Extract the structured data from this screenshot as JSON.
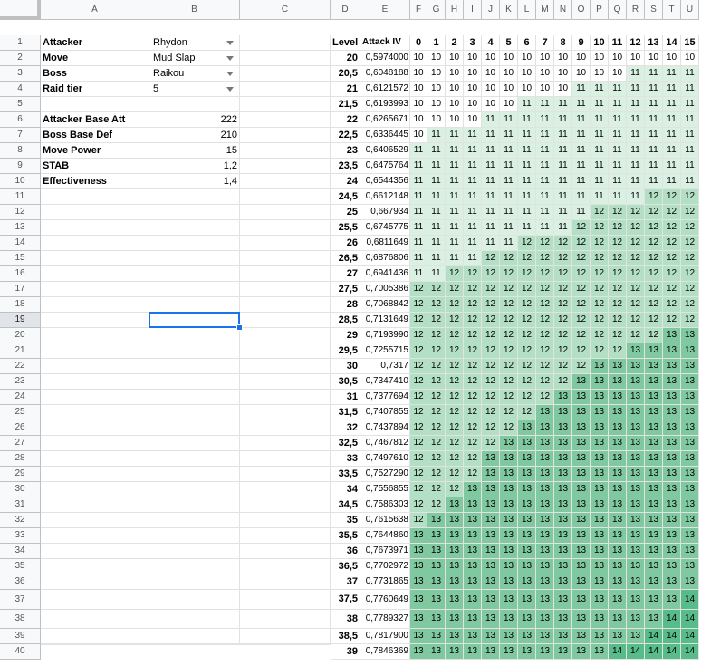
{
  "columns": [
    "A",
    "B",
    "C",
    "D",
    "E",
    "F",
    "G",
    "H",
    "I",
    "J",
    "K",
    "L",
    "M",
    "N",
    "O",
    "P",
    "Q",
    "R",
    "S",
    "T",
    "U"
  ],
  "rows": [
    "1",
    "2",
    "3",
    "4",
    "5",
    "6",
    "7",
    "8",
    "9",
    "10",
    "11",
    "12",
    "13",
    "14",
    "15",
    "16",
    "17",
    "18",
    "19",
    "20",
    "21",
    "22",
    "23",
    "24",
    "25",
    "26",
    "27",
    "28",
    "29",
    "30",
    "31",
    "32",
    "33",
    "34",
    "35",
    "36",
    "37",
    "38",
    "39",
    "40"
  ],
  "active_row": "19",
  "params": [
    {
      "label": "Attacker",
      "value": "Rhydon",
      "dropdown": true
    },
    {
      "label": "Move",
      "value": "Mud Slap",
      "dropdown": true
    },
    {
      "label": "Boss",
      "value": "Raikou",
      "dropdown": true
    },
    {
      "label": "Raid tier",
      "value": "5",
      "dropdown": true
    },
    {
      "label": "",
      "value": "",
      "dropdown": false
    },
    {
      "label": "Attacker Base Att",
      "value": "222",
      "dropdown": false
    },
    {
      "label": "Boss Base Def",
      "value": "210",
      "dropdown": false
    },
    {
      "label": "Move Power",
      "value": "15",
      "dropdown": false
    },
    {
      "label": "STAB",
      "value": "1,2",
      "dropdown": false
    },
    {
      "label": "Effectiveness",
      "value": "1,4",
      "dropdown": false
    }
  ],
  "table_header": {
    "level": "Level",
    "attack_iv": "Attack IV",
    "iv_values": [
      "0",
      "1",
      "2",
      "3",
      "4",
      "5",
      "6",
      "7",
      "8",
      "9",
      "10",
      "11",
      "12",
      "13",
      "14",
      "15"
    ]
  },
  "table_rows": [
    {
      "level": "20",
      "mult": "0,5974000",
      "damage": [
        "10",
        "10",
        "10",
        "10",
        "10",
        "10",
        "10",
        "10",
        "10",
        "10",
        "10",
        "10",
        "10",
        "10",
        "10",
        "10"
      ]
    },
    {
      "level": "20,5",
      "mult": "0,6048188",
      "damage": [
        "10",
        "10",
        "10",
        "10",
        "10",
        "10",
        "10",
        "10",
        "10",
        "10",
        "10",
        "10",
        "11",
        "11",
        "11",
        "11"
      ]
    },
    {
      "level": "21",
      "mult": "0,6121572",
      "damage": [
        "10",
        "10",
        "10",
        "10",
        "10",
        "10",
        "10",
        "10",
        "10",
        "11",
        "11",
        "11",
        "11",
        "11",
        "11",
        "11"
      ]
    },
    {
      "level": "21,5",
      "mult": "0,6193993",
      "damage": [
        "10",
        "10",
        "10",
        "10",
        "10",
        "10",
        "11",
        "11",
        "11",
        "11",
        "11",
        "11",
        "11",
        "11",
        "11",
        "11"
      ]
    },
    {
      "level": "22",
      "mult": "0,6265671",
      "damage": [
        "10",
        "10",
        "10",
        "10",
        "11",
        "11",
        "11",
        "11",
        "11",
        "11",
        "11",
        "11",
        "11",
        "11",
        "11",
        "11"
      ]
    },
    {
      "level": "22,5",
      "mult": "0,6336445",
      "damage": [
        "10",
        "11",
        "11",
        "11",
        "11",
        "11",
        "11",
        "11",
        "11",
        "11",
        "11",
        "11",
        "11",
        "11",
        "11",
        "11"
      ]
    },
    {
      "level": "23",
      "mult": "0,6406529",
      "damage": [
        "11",
        "11",
        "11",
        "11",
        "11",
        "11",
        "11",
        "11",
        "11",
        "11",
        "11",
        "11",
        "11",
        "11",
        "11",
        "11"
      ]
    },
    {
      "level": "23,5",
      "mult": "0,6475764",
      "damage": [
        "11",
        "11",
        "11",
        "11",
        "11",
        "11",
        "11",
        "11",
        "11",
        "11",
        "11",
        "11",
        "11",
        "11",
        "11",
        "11"
      ]
    },
    {
      "level": "24",
      "mult": "0,6544356",
      "damage": [
        "11",
        "11",
        "11",
        "11",
        "11",
        "11",
        "11",
        "11",
        "11",
        "11",
        "11",
        "11",
        "11",
        "11",
        "11",
        "11"
      ]
    },
    {
      "level": "24,5",
      "mult": "0,6612148",
      "damage": [
        "11",
        "11",
        "11",
        "11",
        "11",
        "11",
        "11",
        "11",
        "11",
        "11",
        "11",
        "11",
        "11",
        "12",
        "12",
        "12"
      ]
    },
    {
      "level": "25",
      "mult": "0,667934",
      "damage": [
        "11",
        "11",
        "11",
        "11",
        "11",
        "11",
        "11",
        "11",
        "11",
        "11",
        "12",
        "12",
        "12",
        "12",
        "12",
        "12"
      ]
    },
    {
      "level": "25,5",
      "mult": "0,6745775",
      "damage": [
        "11",
        "11",
        "11",
        "11",
        "11",
        "11",
        "11",
        "11",
        "11",
        "12",
        "12",
        "12",
        "12",
        "12",
        "12",
        "12"
      ]
    },
    {
      "level": "26",
      "mult": "0,6811649",
      "damage": [
        "11",
        "11",
        "11",
        "11",
        "11",
        "11",
        "12",
        "12",
        "12",
        "12",
        "12",
        "12",
        "12",
        "12",
        "12",
        "12"
      ]
    },
    {
      "level": "26,5",
      "mult": "0,6876806",
      "damage": [
        "11",
        "11",
        "11",
        "11",
        "12",
        "12",
        "12",
        "12",
        "12",
        "12",
        "12",
        "12",
        "12",
        "12",
        "12",
        "12"
      ]
    },
    {
      "level": "27",
      "mult": "0,6941436",
      "damage": [
        "11",
        "11",
        "12",
        "12",
        "12",
        "12",
        "12",
        "12",
        "12",
        "12",
        "12",
        "12",
        "12",
        "12",
        "12",
        "12"
      ]
    },
    {
      "level": "27,5",
      "mult": "0,7005386",
      "damage": [
        "12",
        "12",
        "12",
        "12",
        "12",
        "12",
        "12",
        "12",
        "12",
        "12",
        "12",
        "12",
        "12",
        "12",
        "12",
        "12"
      ]
    },
    {
      "level": "28",
      "mult": "0,7068842",
      "damage": [
        "12",
        "12",
        "12",
        "12",
        "12",
        "12",
        "12",
        "12",
        "12",
        "12",
        "12",
        "12",
        "12",
        "12",
        "12",
        "12"
      ]
    },
    {
      "level": "28,5",
      "mult": "0,7131649",
      "damage": [
        "12",
        "12",
        "12",
        "12",
        "12",
        "12",
        "12",
        "12",
        "12",
        "12",
        "12",
        "12",
        "12",
        "12",
        "12",
        "12"
      ]
    },
    {
      "level": "29",
      "mult": "0,7193990",
      "damage": [
        "12",
        "12",
        "12",
        "12",
        "12",
        "12",
        "12",
        "12",
        "12",
        "12",
        "12",
        "12",
        "12",
        "12",
        "13",
        "13"
      ]
    },
    {
      "level": "29,5",
      "mult": "0,7255715",
      "damage": [
        "12",
        "12",
        "12",
        "12",
        "12",
        "12",
        "12",
        "12",
        "12",
        "12",
        "12",
        "12",
        "13",
        "13",
        "13",
        "13"
      ]
    },
    {
      "level": "30",
      "mult": "0,7317",
      "damage": [
        "12",
        "12",
        "12",
        "12",
        "12",
        "12",
        "12",
        "12",
        "12",
        "12",
        "13",
        "13",
        "13",
        "13",
        "13",
        "13"
      ]
    },
    {
      "level": "30,5",
      "mult": "0,7347410",
      "damage": [
        "12",
        "12",
        "12",
        "12",
        "12",
        "12",
        "12",
        "12",
        "12",
        "13",
        "13",
        "13",
        "13",
        "13",
        "13",
        "13"
      ]
    },
    {
      "level": "31",
      "mult": "0,7377694",
      "damage": [
        "12",
        "12",
        "12",
        "12",
        "12",
        "12",
        "12",
        "12",
        "13",
        "13",
        "13",
        "13",
        "13",
        "13",
        "13",
        "13"
      ]
    },
    {
      "level": "31,5",
      "mult": "0,7407855",
      "damage": [
        "12",
        "12",
        "12",
        "12",
        "12",
        "12",
        "12",
        "13",
        "13",
        "13",
        "13",
        "13",
        "13",
        "13",
        "13",
        "13"
      ]
    },
    {
      "level": "32",
      "mult": "0,7437894",
      "damage": [
        "12",
        "12",
        "12",
        "12",
        "12",
        "12",
        "13",
        "13",
        "13",
        "13",
        "13",
        "13",
        "13",
        "13",
        "13",
        "13"
      ]
    },
    {
      "level": "32,5",
      "mult": "0,7467812",
      "damage": [
        "12",
        "12",
        "12",
        "12",
        "12",
        "13",
        "13",
        "13",
        "13",
        "13",
        "13",
        "13",
        "13",
        "13",
        "13",
        "13"
      ]
    },
    {
      "level": "33",
      "mult": "0,7497610",
      "damage": [
        "12",
        "12",
        "12",
        "12",
        "13",
        "13",
        "13",
        "13",
        "13",
        "13",
        "13",
        "13",
        "13",
        "13",
        "13",
        "13"
      ]
    },
    {
      "level": "33,5",
      "mult": "0,7527290",
      "damage": [
        "12",
        "12",
        "12",
        "12",
        "13",
        "13",
        "13",
        "13",
        "13",
        "13",
        "13",
        "13",
        "13",
        "13",
        "13",
        "13"
      ]
    },
    {
      "level": "34",
      "mult": "0,7556855",
      "damage": [
        "12",
        "12",
        "12",
        "13",
        "13",
        "13",
        "13",
        "13",
        "13",
        "13",
        "13",
        "13",
        "13",
        "13",
        "13",
        "13"
      ]
    },
    {
      "level": "34,5",
      "mult": "0,7586303",
      "damage": [
        "12",
        "12",
        "13",
        "13",
        "13",
        "13",
        "13",
        "13",
        "13",
        "13",
        "13",
        "13",
        "13",
        "13",
        "13",
        "13"
      ]
    },
    {
      "level": "35",
      "mult": "0,7615638",
      "damage": [
        "12",
        "13",
        "13",
        "13",
        "13",
        "13",
        "13",
        "13",
        "13",
        "13",
        "13",
        "13",
        "13",
        "13",
        "13",
        "13"
      ]
    },
    {
      "level": "35,5",
      "mult": "0,7644860",
      "damage": [
        "13",
        "13",
        "13",
        "13",
        "13",
        "13",
        "13",
        "13",
        "13",
        "13",
        "13",
        "13",
        "13",
        "13",
        "13",
        "13"
      ]
    },
    {
      "level": "36",
      "mult": "0,7673971",
      "damage": [
        "13",
        "13",
        "13",
        "13",
        "13",
        "13",
        "13",
        "13",
        "13",
        "13",
        "13",
        "13",
        "13",
        "13",
        "13",
        "13"
      ]
    },
    {
      "level": "36,5",
      "mult": "0,7702972",
      "damage": [
        "13",
        "13",
        "13",
        "13",
        "13",
        "13",
        "13",
        "13",
        "13",
        "13",
        "13",
        "13",
        "13",
        "13",
        "13",
        "13"
      ]
    },
    {
      "level": "37",
      "mult": "0,7731865",
      "damage": [
        "13",
        "13",
        "13",
        "13",
        "13",
        "13",
        "13",
        "13",
        "13",
        "13",
        "13",
        "13",
        "13",
        "13",
        "13",
        "13"
      ]
    },
    {
      "level": "37,5",
      "mult": "0,7760649",
      "damage": [
        "13",
        "13",
        "13",
        "13",
        "13",
        "13",
        "13",
        "13",
        "13",
        "13",
        "13",
        "13",
        "13",
        "13",
        "13",
        "14"
      ]
    },
    {
      "level": "38",
      "mult": "0,7789327",
      "damage": [
        "13",
        "13",
        "13",
        "13",
        "13",
        "13",
        "13",
        "13",
        "13",
        "13",
        "13",
        "13",
        "13",
        "13",
        "14",
        "14"
      ]
    },
    {
      "level": "38,5",
      "mult": "0,7817900",
      "damage": [
        "13",
        "13",
        "13",
        "13",
        "13",
        "13",
        "13",
        "13",
        "13",
        "13",
        "13",
        "13",
        "13",
        "14",
        "14",
        "14"
      ]
    },
    {
      "level": "39",
      "mult": "0,7846369",
      "damage": [
        "13",
        "13",
        "13",
        "13",
        "13",
        "13",
        "13",
        "13",
        "13",
        "13",
        "13",
        "14",
        "14",
        "14",
        "14",
        "14"
      ]
    }
  ],
  "colors": {
    "10": "#ffffff",
    "11": "#d9f0e2",
    "12": "#b3e0c4",
    "13": "#80c9a0",
    "14": "#57bb8a",
    "grid": "#e2e2e2",
    "header_bg": "#f8f9fa",
    "selection": "#1a73e8"
  }
}
